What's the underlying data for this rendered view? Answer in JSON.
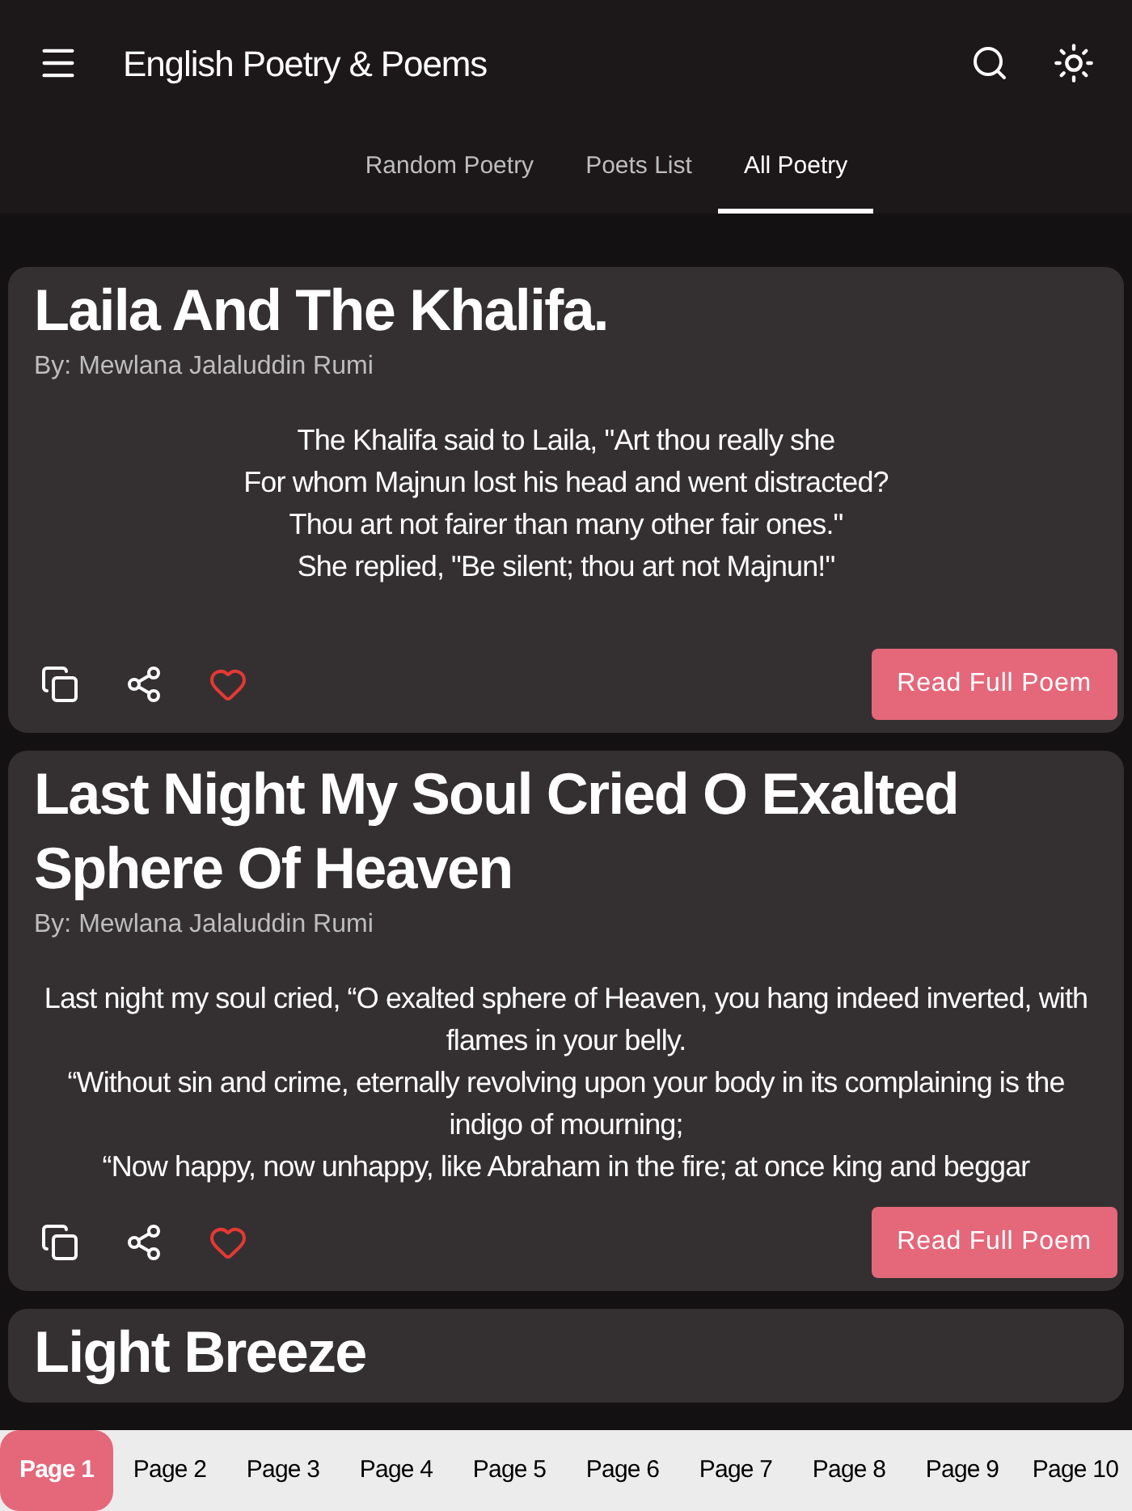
{
  "app_bar": {
    "title": "English Poetry & Poems"
  },
  "tabs": [
    {
      "label": "Random Poetry",
      "selected": false
    },
    {
      "label": "Poets List",
      "selected": false
    },
    {
      "label": "All Poetry",
      "selected": true
    }
  ],
  "poems": [
    {
      "title": "Laila And The Khalifa.",
      "author": "By: Mewlana Jalaluddin Rumi",
      "lines": [
        "The Khalifa said to Laila, \"Art thou really she",
        "For whom Majnun lost his head and went distracted?",
        "Thou art not fairer than many other fair ones.\"",
        "She replied, \"Be silent; thou art not Majnun!\""
      ],
      "favorite": false,
      "button": "Read Full Poem"
    },
    {
      "title": "Last Night My Soul Cried O Exalted Sphere Of Heaven",
      "author": "By: Mewlana Jalaluddin Rumi",
      "lines": [
        "Last night my soul cried, “O exalted sphere of Heaven, you hang indeed inverted, with flames in your belly.",
        "“Without sin and crime, eternally revolving upon your body in its complaining is the indigo of mourning;",
        "“Now happy, now unhappy, like Abraham in the fire; at once king and beggar"
      ],
      "favorite": false,
      "button": "Read Full Poem"
    },
    {
      "title": "Light Breeze"
    }
  ],
  "pages": [
    {
      "label": "Page 1",
      "selected": true
    },
    {
      "label": "Page 2",
      "selected": false
    },
    {
      "label": "Page 3",
      "selected": false
    },
    {
      "label": "Page 4",
      "selected": false
    },
    {
      "label": "Page 5",
      "selected": false
    },
    {
      "label": "Page 6",
      "selected": false
    },
    {
      "label": "Page 7",
      "selected": false
    },
    {
      "label": "Page 8",
      "selected": false
    },
    {
      "label": "Page 9",
      "selected": false
    },
    {
      "label": "Page 10",
      "selected": false
    }
  ]
}
